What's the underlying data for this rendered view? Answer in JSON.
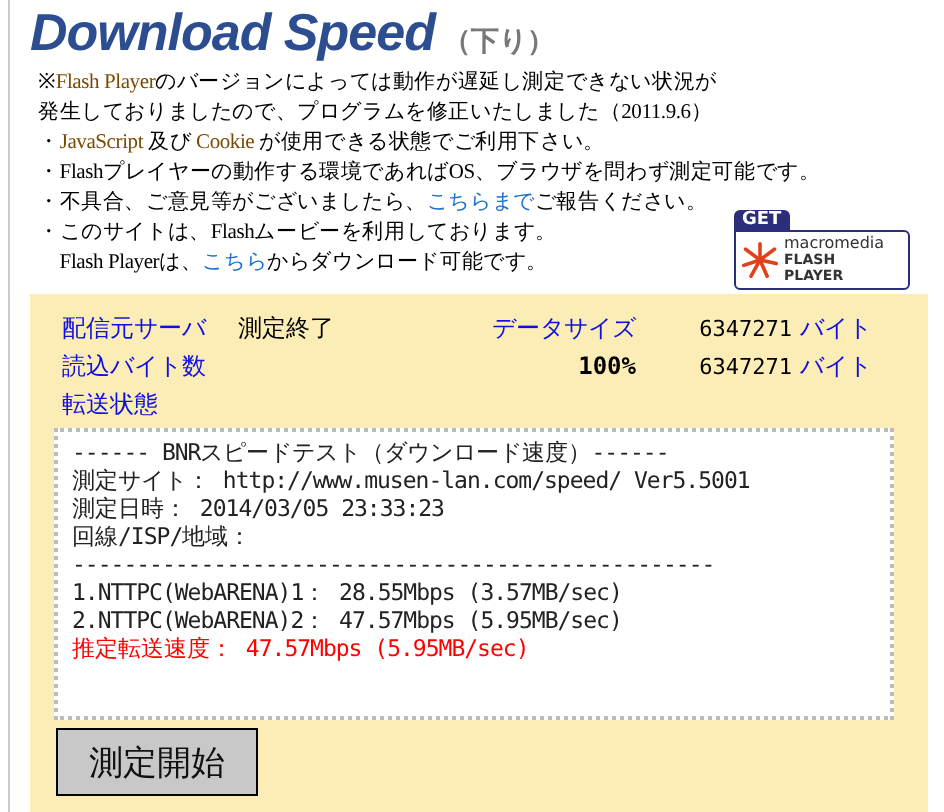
{
  "header": {
    "title": "Download Speed",
    "subtitle": "（下り）"
  },
  "notice": [
    [
      {
        "kind": "plain",
        "text": "※"
      },
      {
        "kind": "term",
        "text": "Flash Player"
      },
      {
        "kind": "plain",
        "text": "のバージョンによっては動作が遅延し測定できない状況が"
      }
    ],
    [
      {
        "kind": "plain",
        "text": "発生しておりましたので、プログラムを修正いたしました（2011.9.6）"
      }
    ],
    [
      {
        "kind": "plain",
        "text": "・"
      },
      {
        "kind": "term",
        "text": "JavaScript"
      },
      {
        "kind": "plain",
        "text": " 及び "
      },
      {
        "kind": "term",
        "text": "Cookie"
      },
      {
        "kind": "plain",
        "text": " が使用できる状態でご利用下さい。"
      }
    ],
    [
      {
        "kind": "plain",
        "text": "・Flashプレイヤーの動作する環境であればOS、ブラウザを問わず測定可能です。"
      }
    ],
    [
      {
        "kind": "plain",
        "text": "・不具合、ご意見等がございましたら、"
      },
      {
        "kind": "link",
        "text": "こちらまで"
      },
      {
        "kind": "plain",
        "text": "ご報告ください。"
      }
    ],
    [
      {
        "kind": "plain",
        "text": "・このサイトは、Flashムービーを利用しております。"
      }
    ],
    [
      {
        "kind": "plain",
        "text": "　Flash Playerは、"
      },
      {
        "kind": "link",
        "text": "こちら"
      },
      {
        "kind": "plain",
        "text": "からダウンロード可能です。"
      }
    ]
  ],
  "flash_badge": {
    "get": "GET",
    "brand": "macromedia",
    "product": "FLASH",
    "product_2": "PLAYER"
  },
  "status": {
    "server_label": "配信元サーバ",
    "state": "測定終了",
    "size_label": "データサイズ",
    "size": "6347271",
    "size_unit": "バイト",
    "read_label": "読込バイト数",
    "percent": "100%",
    "read": "6347271",
    "read_unit": "バイト",
    "transfer_label": "転送状態"
  },
  "result_lines": [
    {
      "kind": "normal",
      "text": "------ BNRスピードテスト（ダウンロード速度）------"
    },
    {
      "kind": "normal",
      "text": "測定サイト： http://www.musen-lan.com/speed/ Ver5.5001"
    },
    {
      "kind": "normal",
      "text": "測定日時： 2014/03/05 23:33:23"
    },
    {
      "kind": "normal",
      "text": "回線/ISP/地域："
    },
    {
      "kind": "normal",
      "text": "--------------------------------------------------"
    },
    {
      "kind": "normal",
      "text": "1.NTTPC(WebARENA)1： 28.55Mbps (3.57MB/sec)"
    },
    {
      "kind": "normal",
      "text": "2.NTTPC(WebARENA)2： 47.57Mbps (5.95MB/sec)"
    },
    {
      "kind": "highlight",
      "text": "推定転送速度： 47.57Mbps (5.95MB/sec)"
    }
  ],
  "start_button": "測定開始"
}
